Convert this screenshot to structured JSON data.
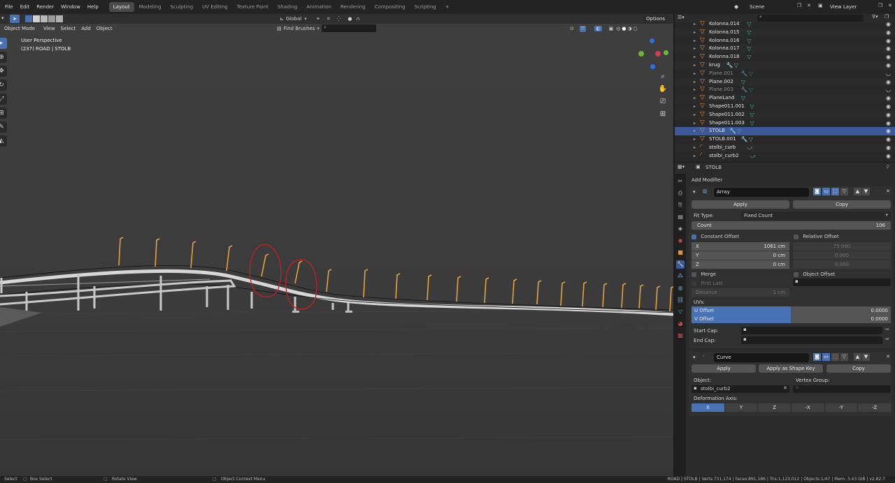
{
  "menubar": {
    "menus": [
      "File",
      "Edit",
      "Render",
      "Window",
      "Help"
    ],
    "workspaces": [
      "Layout",
      "Modeling",
      "Sculpting",
      "UV Editing",
      "Texture Paint",
      "Shading",
      "Animation",
      "Rendering",
      "Compositing",
      "Scripting"
    ],
    "active_workspace": "Layout",
    "add_tab": "+",
    "scene_label": "Scene",
    "view_layer_label": "View Layer"
  },
  "viewport": {
    "mode": "Object Mode",
    "menus": [
      "View",
      "Select",
      "Add",
      "Object"
    ],
    "orientation": "Global",
    "options": "Options",
    "find_brushes": "Find Brushes",
    "overlay_line1": "User Perspective",
    "overlay_line2": "(237) ROAD | STOLB",
    "annotation_color": "#cc1f1f",
    "post_color": "#e8a23a"
  },
  "outliner": {
    "rows": [
      {
        "name": "Kolonna.014",
        "dim": false,
        "modifier": false
      },
      {
        "name": "Kolonna.015",
        "dim": false,
        "modifier": false
      },
      {
        "name": "Kolonna.016",
        "dim": false,
        "modifier": false
      },
      {
        "name": "Kolonna.017",
        "dim": false,
        "modifier": false
      },
      {
        "name": "Kolonna.018",
        "dim": false,
        "modifier": false
      },
      {
        "name": "krug",
        "dim": false,
        "modifier": true
      },
      {
        "name": "Plane.001",
        "dim": true,
        "modifier": true
      },
      {
        "name": "Plane.002",
        "dim": false,
        "modifier": false
      },
      {
        "name": "Plane.003",
        "dim": true,
        "modifier": true
      },
      {
        "name": "PlaneLand",
        "dim": false,
        "modifier": false
      },
      {
        "name": "Shape011.001",
        "dim": false,
        "modifier": false
      },
      {
        "name": "Shape011.002",
        "dim": false,
        "modifier": false
      },
      {
        "name": "Shape011.003",
        "dim": false,
        "modifier": false
      },
      {
        "name": "STOLB",
        "dim": false,
        "modifier": true,
        "selected": true
      },
      {
        "name": "STOLB.001",
        "dim": false,
        "modifier": true
      },
      {
        "name": "stolbi_curb",
        "dim": false,
        "modifier": false,
        "curve": true
      },
      {
        "name": "stolbi_curb2",
        "dim": false,
        "modifier": false,
        "curve": true
      }
    ]
  },
  "properties": {
    "object_name": "STOLB",
    "add_modifier": "Add Modifier",
    "array": {
      "name": "Array",
      "apply": "Apply",
      "copy": "Copy",
      "fit_type_label": "Fit Type:",
      "fit_type_value": "Fixed Count",
      "count_label": "Count",
      "count_value": "106",
      "constant_offset": "Constant Offset",
      "relative_offset": "Relative Offset",
      "const": [
        {
          "axis": "X",
          "value": "1061 cm"
        },
        {
          "axis": "Y",
          "value": "0 cm"
        },
        {
          "axis": "Z",
          "value": "0 cm"
        }
      ],
      "rel": [
        "75.000",
        "0.000",
        "0.000"
      ],
      "merge": "Merge",
      "first_last": "First Last",
      "distance_label": "Distance",
      "distance_value": "1 cm",
      "object_offset": "Object Offset",
      "uvs_label": "UVs:",
      "u_offset_label": "U Offset",
      "u_offset_value": "0.0000",
      "v_offset_label": "V Offset",
      "v_offset_value": "0.0000",
      "start_cap": "Start Cap:",
      "end_cap": "End Cap:"
    },
    "curve": {
      "name": "Curve",
      "apply": "Apply",
      "apply_shape": "Apply as Shape Key",
      "copy": "Copy",
      "object_label": "Object:",
      "object_value": "stolbi_curb2",
      "vertex_group_label": "Vertex Group:",
      "deform_label": "Deformation Axis:",
      "axes": [
        "X",
        "Y",
        "Z",
        "-X",
        "-Y",
        "-Z"
      ],
      "active_axis": "X"
    }
  },
  "statusbar": {
    "select": "Select",
    "box_select": "Box Select",
    "rotate": "Rotate View",
    "context_menu": "Object Context Menu",
    "stats": "ROAD | STOLB | Verts:731,174 | Faces:891,186 | Tris:1,123,012 | Objects:1/47 | Mem: 3.43 GiB | v2.82.7"
  }
}
